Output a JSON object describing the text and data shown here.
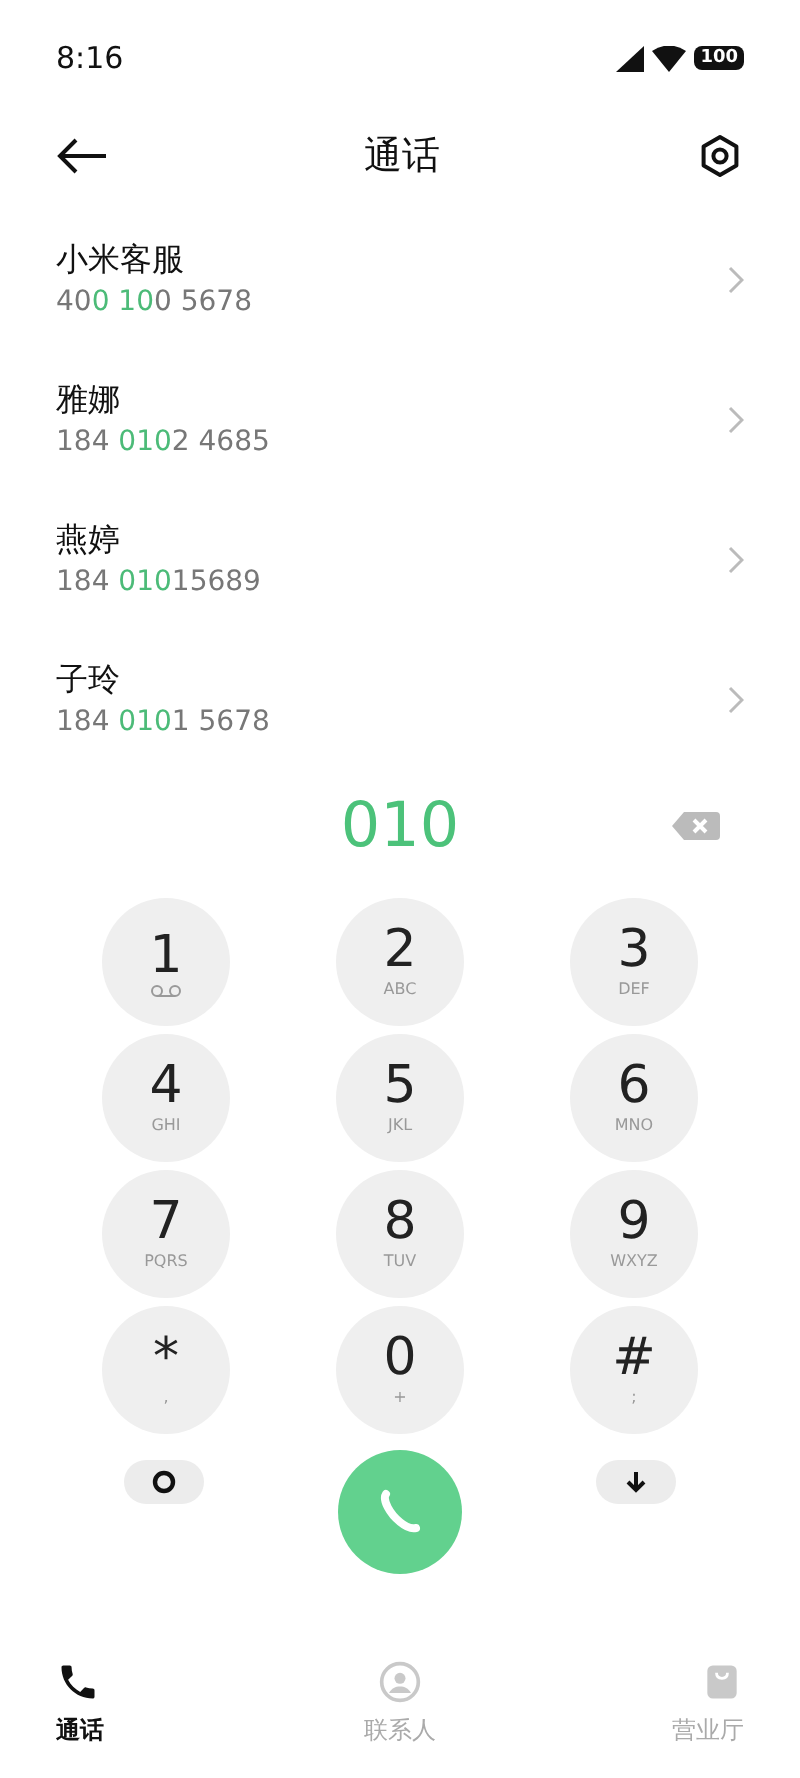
{
  "status_bar": {
    "time": "8:16",
    "battery": "100"
  },
  "header": {
    "title": "通话"
  },
  "contacts": [
    {
      "name": "小米客服",
      "number": [
        {
          "text": "40",
          "match": false
        },
        {
          "text": "0 10",
          "match": true
        },
        {
          "text": "0 5678",
          "match": false
        }
      ]
    },
    {
      "name": "雅娜",
      "number": [
        {
          "text": "184 ",
          "match": false
        },
        {
          "text": "010",
          "match": true
        },
        {
          "text": "2 4685",
          "match": false
        }
      ]
    },
    {
      "name": "燕婷",
      "number": [
        {
          "text": "184 ",
          "match": false
        },
        {
          "text": "010",
          "match": true
        },
        {
          "text": "15689",
          "match": false
        }
      ]
    },
    {
      "name": "子玲",
      "number": [
        {
          "text": "184 ",
          "match": false
        },
        {
          "text": "010",
          "match": true
        },
        {
          "text": "1 5678",
          "match": false
        }
      ]
    }
  ],
  "dialed": "010",
  "keys": [
    {
      "digit": "1",
      "kind": "voicemail"
    },
    {
      "digit": "2",
      "sub": "ABC",
      "kind": "text"
    },
    {
      "digit": "3",
      "sub": "DEF",
      "kind": "text"
    },
    {
      "digit": "4",
      "sub": "GHI",
      "kind": "text"
    },
    {
      "digit": "5",
      "sub": "JKL",
      "kind": "text"
    },
    {
      "digit": "6",
      "sub": "MNO",
      "kind": "text"
    },
    {
      "digit": "7",
      "sub": "PQRS",
      "kind": "text"
    },
    {
      "digit": "8",
      "sub": "TUV",
      "kind": "text"
    },
    {
      "digit": "9",
      "sub": "WXYZ",
      "kind": "text"
    },
    {
      "digit": "*",
      "sub": ",",
      "kind": "text"
    },
    {
      "digit": "0",
      "sub": "+",
      "kind": "text"
    },
    {
      "digit": "#",
      "sub": ";",
      "kind": "text"
    }
  ],
  "tabs": [
    {
      "label": "通话",
      "kind": "phone",
      "selected": true
    },
    {
      "label": "联系人",
      "kind": "person",
      "selected": false
    },
    {
      "label": "营业厅",
      "kind": "bag",
      "selected": false
    }
  ]
}
